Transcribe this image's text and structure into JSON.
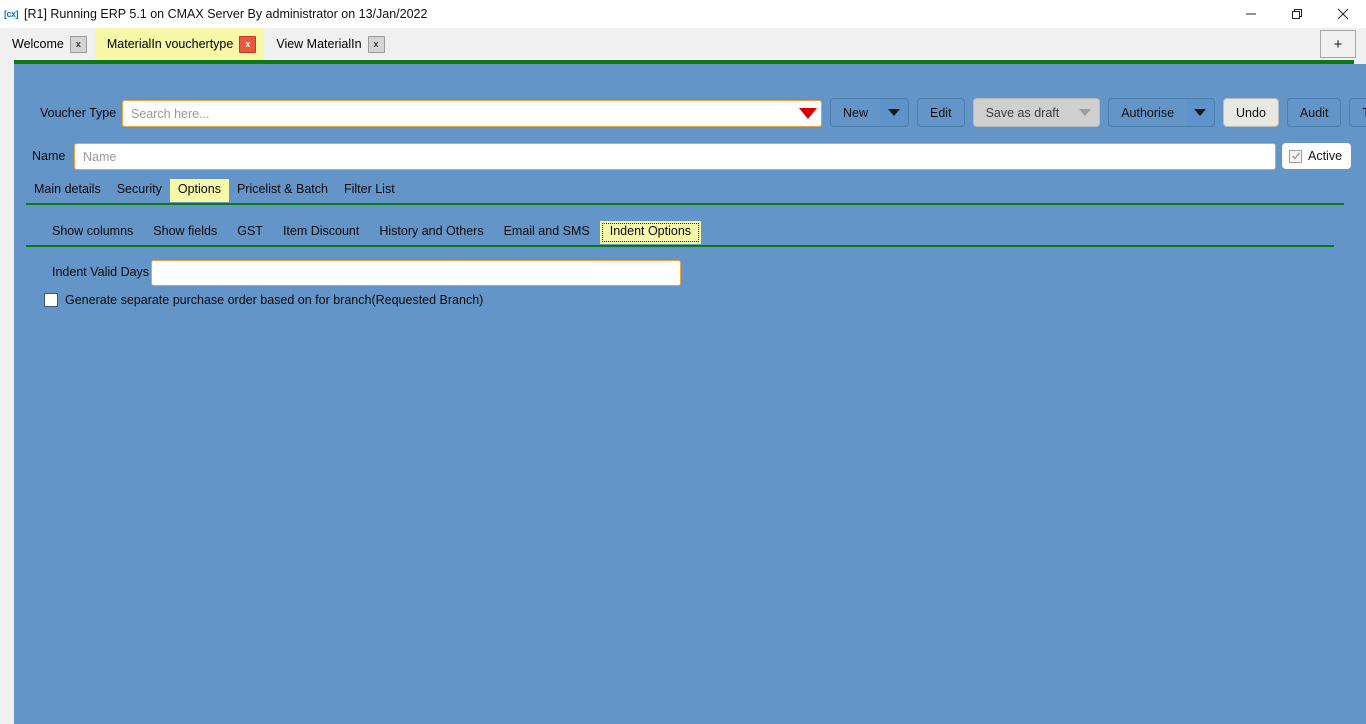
{
  "window": {
    "icon": "app-icon",
    "title": "[R1] Running ERP 5.1 on CMAX Server By administrator on 13/Jan/2022",
    "controls": {
      "minimize": "minimize-icon",
      "maximize": "maximize-icon",
      "close": "close-icon"
    }
  },
  "tabstrip": {
    "tabs": [
      {
        "label": "Welcome",
        "active": false,
        "close": "x"
      },
      {
        "label": "MaterialIn vouchertype",
        "active": true,
        "close": "x"
      },
      {
        "label": "View MaterialIn",
        "active": false,
        "close": "x"
      }
    ],
    "new_tab_label": "+"
  },
  "form": {
    "voucher_type_label": "Voucher Type",
    "voucher_type_value": "",
    "voucher_type_placeholder": "Search here...",
    "name_label": "Name",
    "name_value": "",
    "name_placeholder": "Name",
    "active_label": "Active",
    "active_checked": true
  },
  "toolbar": {
    "buttons": [
      {
        "label": "New",
        "type": "split",
        "disabled": false
      },
      {
        "label": "Edit",
        "type": "plain",
        "disabled": false
      },
      {
        "label": "Save as draft",
        "type": "split",
        "disabled": true
      },
      {
        "label": "Authorise",
        "type": "split",
        "disabled": false
      },
      {
        "label": "Undo",
        "type": "plain",
        "disabled": false,
        "light": true
      },
      {
        "label": "Audit",
        "type": "plain",
        "disabled": false
      },
      {
        "label": "Template",
        "type": "plain",
        "disabled": false
      }
    ]
  },
  "primary_tabs": [
    {
      "label": "Main details",
      "selected": false
    },
    {
      "label": "Security",
      "selected": false
    },
    {
      "label": "Options",
      "selected": true
    },
    {
      "label": "Pricelist & Batch",
      "selected": false
    },
    {
      "label": "Filter List",
      "selected": false
    }
  ],
  "secondary_tabs": [
    {
      "label": "Show columns",
      "selected": false
    },
    {
      "label": "Show fields",
      "selected": false
    },
    {
      "label": "GST",
      "selected": false
    },
    {
      "label": "Item Discount",
      "selected": false
    },
    {
      "label": "History and Others",
      "selected": false
    },
    {
      "label": "Email and SMS",
      "selected": false
    },
    {
      "label": "Indent Options",
      "selected": true
    }
  ],
  "content": {
    "indent_valid_days_label": "Indent Valid Days",
    "indent_valid_days_value": "",
    "generate_po_checkbox_label": "Generate separate purchase order based on for branch(Requested Branch)",
    "generate_po_checked": false
  },
  "colors": {
    "panel_bg": "#6495c8",
    "accent_green": "#0b7a12",
    "highlight_yellow": "#f7f7a8",
    "field_border": "#e8a33d",
    "dropdown_red": "#d90000"
  }
}
